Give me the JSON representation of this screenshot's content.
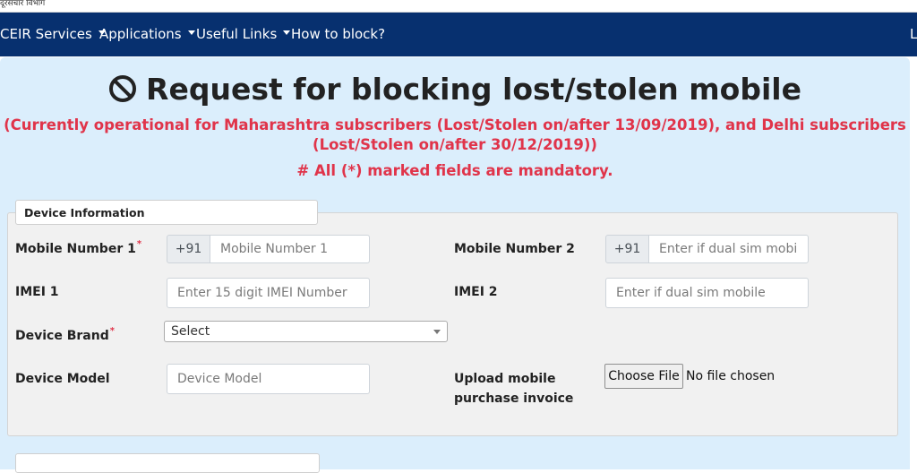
{
  "top_strip": {
    "text": "दूरसंचार विभाग"
  },
  "nav": {
    "items": [
      {
        "label": "CEIR Services",
        "has_caret": true
      },
      {
        "label": "Applications",
        "has_caret": true
      },
      {
        "label": "Useful Links",
        "has_caret": true
      },
      {
        "label": "How to block?",
        "has_caret": false
      }
    ],
    "right_label": "L",
    "background": "#07306f"
  },
  "page": {
    "title": "Request for blocking lost/stolen mobile",
    "notice_line1": "(Currently operational for Maharashtra subscribers (Lost/Stolen on/after 13/09/2019), and Delhi subscribers",
    "notice_line2": "(Lost/Stolen on/after 30/12/2019))",
    "mandatory_note": "# All (*) marked fields are mandatory.",
    "accent_red": "#e0344a",
    "panel_bg": "#dbeefc"
  },
  "form": {
    "section_title": "Device Information",
    "mobile1": {
      "label": "Mobile Number 1",
      "required_mark": "*",
      "prefix": "+91",
      "placeholder": "Mobile Number 1"
    },
    "mobile2": {
      "label": "Mobile Number 2",
      "prefix": "+91",
      "placeholder": "Enter if dual sim mobile"
    },
    "imei1": {
      "label": "IMEI 1",
      "placeholder": "Enter 15 digit IMEI Number"
    },
    "imei2": {
      "label": "IMEI 2",
      "placeholder": "Enter if dual sim mobile"
    },
    "brand": {
      "label": "Device Brand",
      "required_mark": "*",
      "selected": "Select"
    },
    "model": {
      "label": "Device Model",
      "placeholder": "Device Model"
    },
    "invoice": {
      "label_line1": "Upload mobile",
      "label_line2": "purchase invoice",
      "button": "Choose File",
      "status": "No file chosen"
    }
  }
}
